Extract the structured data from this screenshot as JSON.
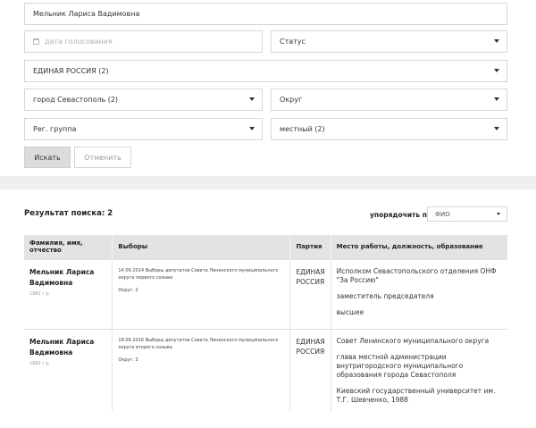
{
  "search": {
    "name_value": "Мельник Лариса Вадимовна",
    "date_placeholder": "дата голосования",
    "status_value": "Статус",
    "party_value": "ЕДИНАЯ РОССИЯ (2)",
    "region_value": "город Севастополь (2)",
    "district_value": "Округ",
    "reg_group_value": "Рег. группа",
    "level_value": "местный (2)",
    "search_button": "Искать",
    "cancel_button": "Отменить"
  },
  "results": {
    "count_label": "Результат поиска: 2",
    "sort_label": "упорядочить по",
    "sort_value": "ФИО",
    "columns": [
      "Фамилия, имя, отчество",
      "Выборы",
      "Партия",
      "Место работы, должность, образование"
    ],
    "rows": [
      {
        "name": "Мельник Лариса Вадимовна",
        "year": "1962 г.р.",
        "election": "14.09.2014 Выборы депутатов Совета Ленинского муниципального округа первого созыва",
        "okrug": "Округ: 2",
        "party": "ЕДИНАЯ РОССИЯ",
        "job1": "Исполком Севастопольского отделения ОНФ \"За Россию\"",
        "job2": "заместитель председателя",
        "job3": "высшее"
      },
      {
        "name": "Мельник Лариса Вадимовна",
        "year": "1962 г.р.",
        "election": "18.09.2016 Выборы депутатов Совета Ленинского муниципального округа второго созыва",
        "okrug": "Округ: 3",
        "party": "ЕДИНАЯ РОССИЯ",
        "job1": "Совет Ленинского муниципального округа",
        "job2": "глава местной администрации внутригородского муниципального образования города Севастополя",
        "job3": "Киевский государственный университет им. Т.Г. Шевченко, 1988"
      }
    ]
  }
}
